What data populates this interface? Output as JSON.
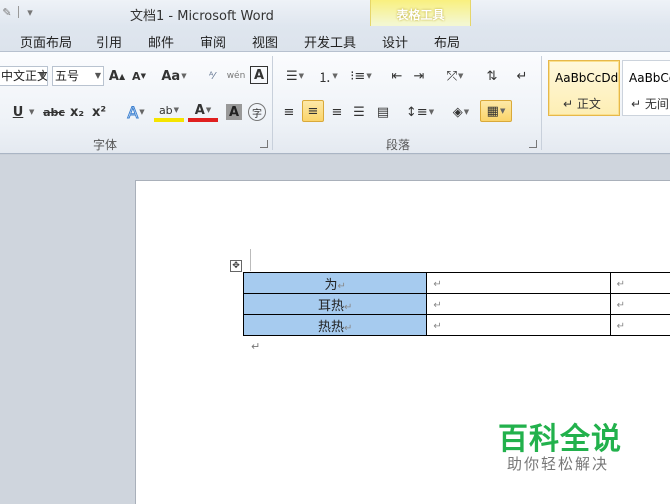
{
  "window": {
    "title": "文档1  -  Microsoft Word"
  },
  "context_band": {
    "title": "表格工具"
  },
  "tabs": [
    {
      "label": "页面布局"
    },
    {
      "label": "引用"
    },
    {
      "label": "邮件"
    },
    {
      "label": "审阅"
    },
    {
      "label": "视图"
    },
    {
      "label": "开发工具"
    },
    {
      "label": "设计"
    },
    {
      "label": "布局"
    }
  ],
  "font_group": {
    "label": "字体",
    "font_name": "中文正文",
    "font_size": "五号",
    "buttons": {
      "grow": "A",
      "shrink": "A",
      "change_case": "Aa",
      "phonetic": "wén",
      "char_border": "A",
      "underline": "U",
      "strike": "abc",
      "subscript": "x₂",
      "superscript": "x²",
      "text_effect": "A",
      "highlight": "ab",
      "font_color": "A",
      "char_shading": "A",
      "enclose": "字"
    }
  },
  "paragraph_group": {
    "label": "段落"
  },
  "styles": [
    {
      "sample": "AaBbCcDd",
      "name": "正文"
    },
    {
      "sample": "AaBbCc",
      "name": "无间"
    }
  ],
  "table": {
    "rows": [
      {
        "cells": [
          "为",
          "",
          ""
        ]
      },
      {
        "cells": [
          "耳热",
          "",
          ""
        ]
      },
      {
        "cells": [
          "热热",
          "",
          ""
        ]
      }
    ]
  },
  "watermark": {
    "title": "百科全说",
    "subtitle": "助你轻松解决"
  },
  "colors": {
    "accent_selection": "#a6cbef",
    "context_band": "#f9f07f",
    "watermark_green": "#22b14c"
  }
}
